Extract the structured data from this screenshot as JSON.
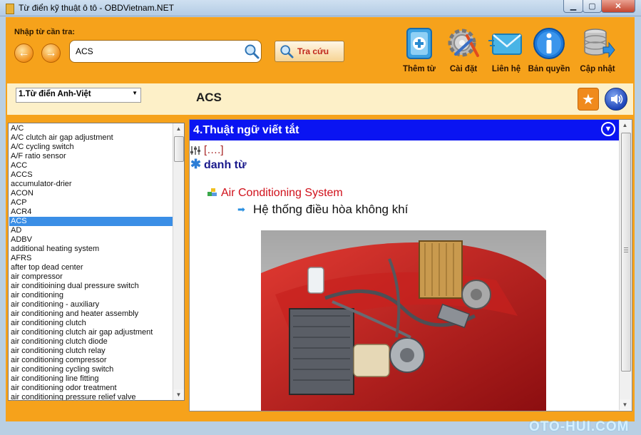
{
  "window": {
    "title": "Từ điển kỹ thuật ô tô - OBDVietnam.NET"
  },
  "search": {
    "label": "Nhập từ cần tra:",
    "value": "ACS",
    "lookup_label": "Tra cứu"
  },
  "toolbar": {
    "add_word": "Thêm từ",
    "settings": "Cài đặt",
    "contact": "Liên hệ",
    "copyright": "Bản quyền",
    "update": "Cập nhật"
  },
  "dictionary": {
    "selected": "1.Từ điển Anh-Việt"
  },
  "current_word": "ACS",
  "word_list": [
    "A/C",
    "A/C clutch air gap adjustment",
    "A/C cycling switch",
    "A/F ratio sensor",
    "ACC",
    "ACCS",
    "accumulator-drier",
    "ACON",
    "ACP",
    "ACR4",
    "ACS",
    "AD",
    "ADBV",
    "additional heating system",
    "AFRS",
    "after top dead center",
    "air compressor",
    "air conditioining dual pressure switch",
    "air conditioning",
    "air conditioning - auxiliary",
    "air conditioning and heater assembly",
    "air conditioning clutch",
    "air conditioning clutch air gap adjustment",
    "air conditioning clutch diode",
    "air conditioning clutch relay",
    "air conditioning compressor",
    "air conditioning cycling switch",
    "air conditioning line fitting",
    "air conditioning odor treatment",
    "air conditioning pressure relief valve"
  ],
  "selected_word_index": 10,
  "entry": {
    "section_title": "4.Thuật ngữ viết tắt",
    "pronunciation": "[….]",
    "word_type": "danh từ",
    "term": "Air Conditioning System",
    "meaning": "Hệ thống điều hòa không khí"
  },
  "watermark": "OTO-HUI.COM",
  "colors": {
    "app_bg": "#f6a21b",
    "band_bg": "#fdf0c8",
    "section_header": "#0a14f2",
    "selection": "#3a8ee6",
    "term": "#d0101a"
  }
}
